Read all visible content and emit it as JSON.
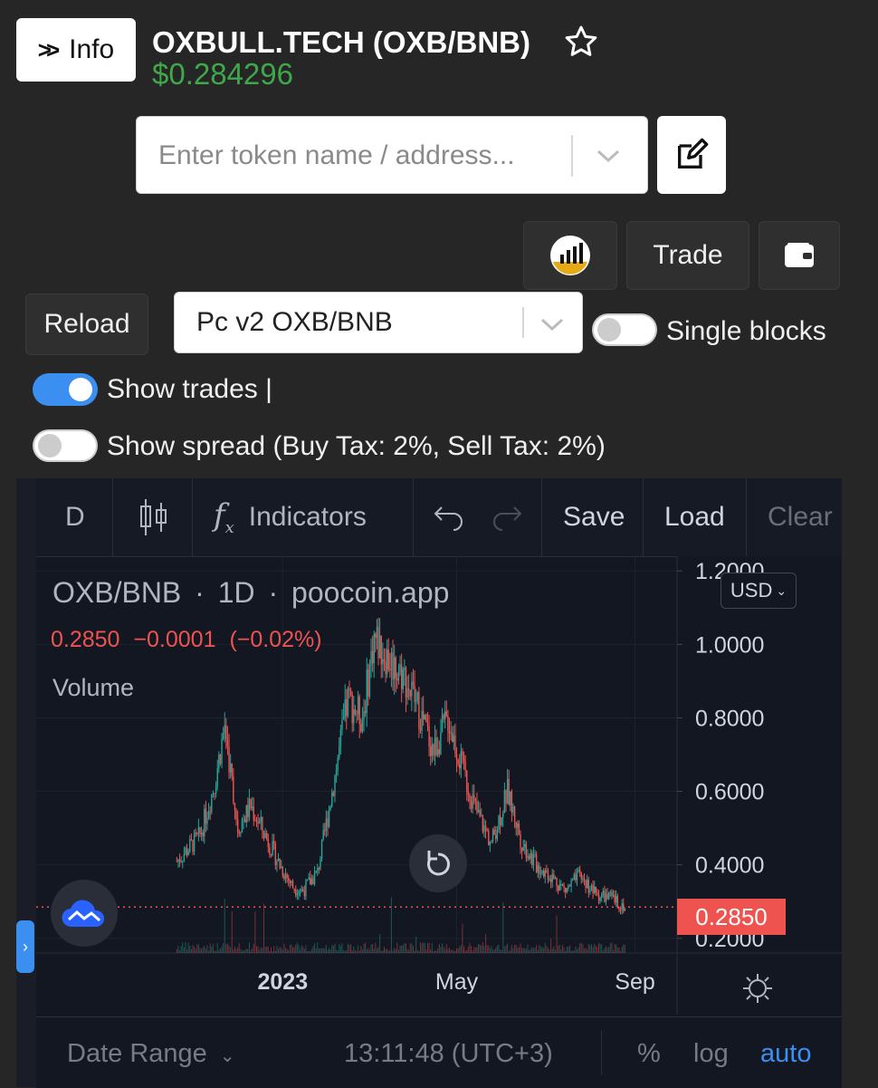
{
  "header": {
    "info_label": "Info",
    "title": "OXBULL.TECH (OXB/BNB)",
    "price": "$0.284296"
  },
  "search": {
    "placeholder": "Enter token name / address..."
  },
  "actions": {
    "trade_label": "Trade"
  },
  "controls": {
    "reload_label": "Reload",
    "pair_selected": "Pc v2 OXB/BNB",
    "single_blocks_label": "Single blocks",
    "single_blocks_on": false,
    "show_trades_label": "Show trades |",
    "show_trades_on": true,
    "show_spread_label": "Show spread (Buy Tax: 2%, Sell Tax: 2%)",
    "show_spread_on": false
  },
  "chart_toolbar": {
    "interval": "D",
    "indicators_label": "Indicators",
    "save_label": "Save",
    "load_label": "Load",
    "clear_label": "Clear"
  },
  "legend": {
    "symbol": "OXB/BNB",
    "interval": "1D",
    "source": "poocoin.app",
    "dot": "·",
    "last": "0.2850",
    "change": "−0.0001",
    "change_pct": "(−0.02%)",
    "volume_label": "Volume"
  },
  "currency": "USD",
  "chart_data": {
    "type": "line",
    "subtype": "candlestick",
    "x_tick_labels": [
      "2023",
      "May",
      "Sep"
    ],
    "y_tick_labels": [
      "1.2000",
      "1.0000",
      "0.8000",
      "0.6000",
      "0.4000",
      "0.2000"
    ],
    "ylim": [
      0.16,
      1.24
    ],
    "last_price_label": "0.2850",
    "series": [
      {
        "x": [
          "2022-10-20",
          "2022-11-05",
          "2022-11-15",
          "2022-11-22",
          "2022-12-01",
          "2022-12-10",
          "2022-12-20",
          "2022-12-30",
          "2023-01-08",
          "2023-01-15",
          "2023-01-25",
          "2023-02-05",
          "2023-02-15",
          "2023-02-25",
          "2023-03-05",
          "2023-03-15",
          "2023-03-25",
          "2023-04-05",
          "2023-04-15",
          "2023-04-25",
          "2023-05-05",
          "2023-05-15",
          "2023-05-25",
          "2023-06-05",
          "2023-06-15",
          "2023-06-25",
          "2023-07-05",
          "2023-07-15",
          "2023-07-25",
          "2023-08-05",
          "2023-08-15",
          "2023-08-25"
        ],
        "y": [
          0.41,
          0.48,
          0.62,
          0.78,
          0.5,
          0.56,
          0.48,
          0.4,
          0.34,
          0.33,
          0.38,
          0.62,
          0.85,
          0.8,
          1.02,
          0.96,
          0.92,
          0.82,
          0.71,
          0.8,
          0.66,
          0.54,
          0.46,
          0.6,
          0.46,
          0.4,
          0.37,
          0.33,
          0.37,
          0.32,
          0.31,
          0.285
        ]
      }
    ],
    "volume_label": "Volume",
    "grid": true
  },
  "bottom_bar": {
    "date_range_label": "Date Range",
    "time": "13:11:48 (UTC+3)",
    "percent_label": "%",
    "log_label": "log",
    "auto_label": "auto"
  },
  "colors": {
    "price_green": "#3fa84a",
    "up": "#26a69a",
    "down": "#ef5350",
    "accent_blue": "#3b8ff0",
    "chart_bg": "#131722"
  }
}
